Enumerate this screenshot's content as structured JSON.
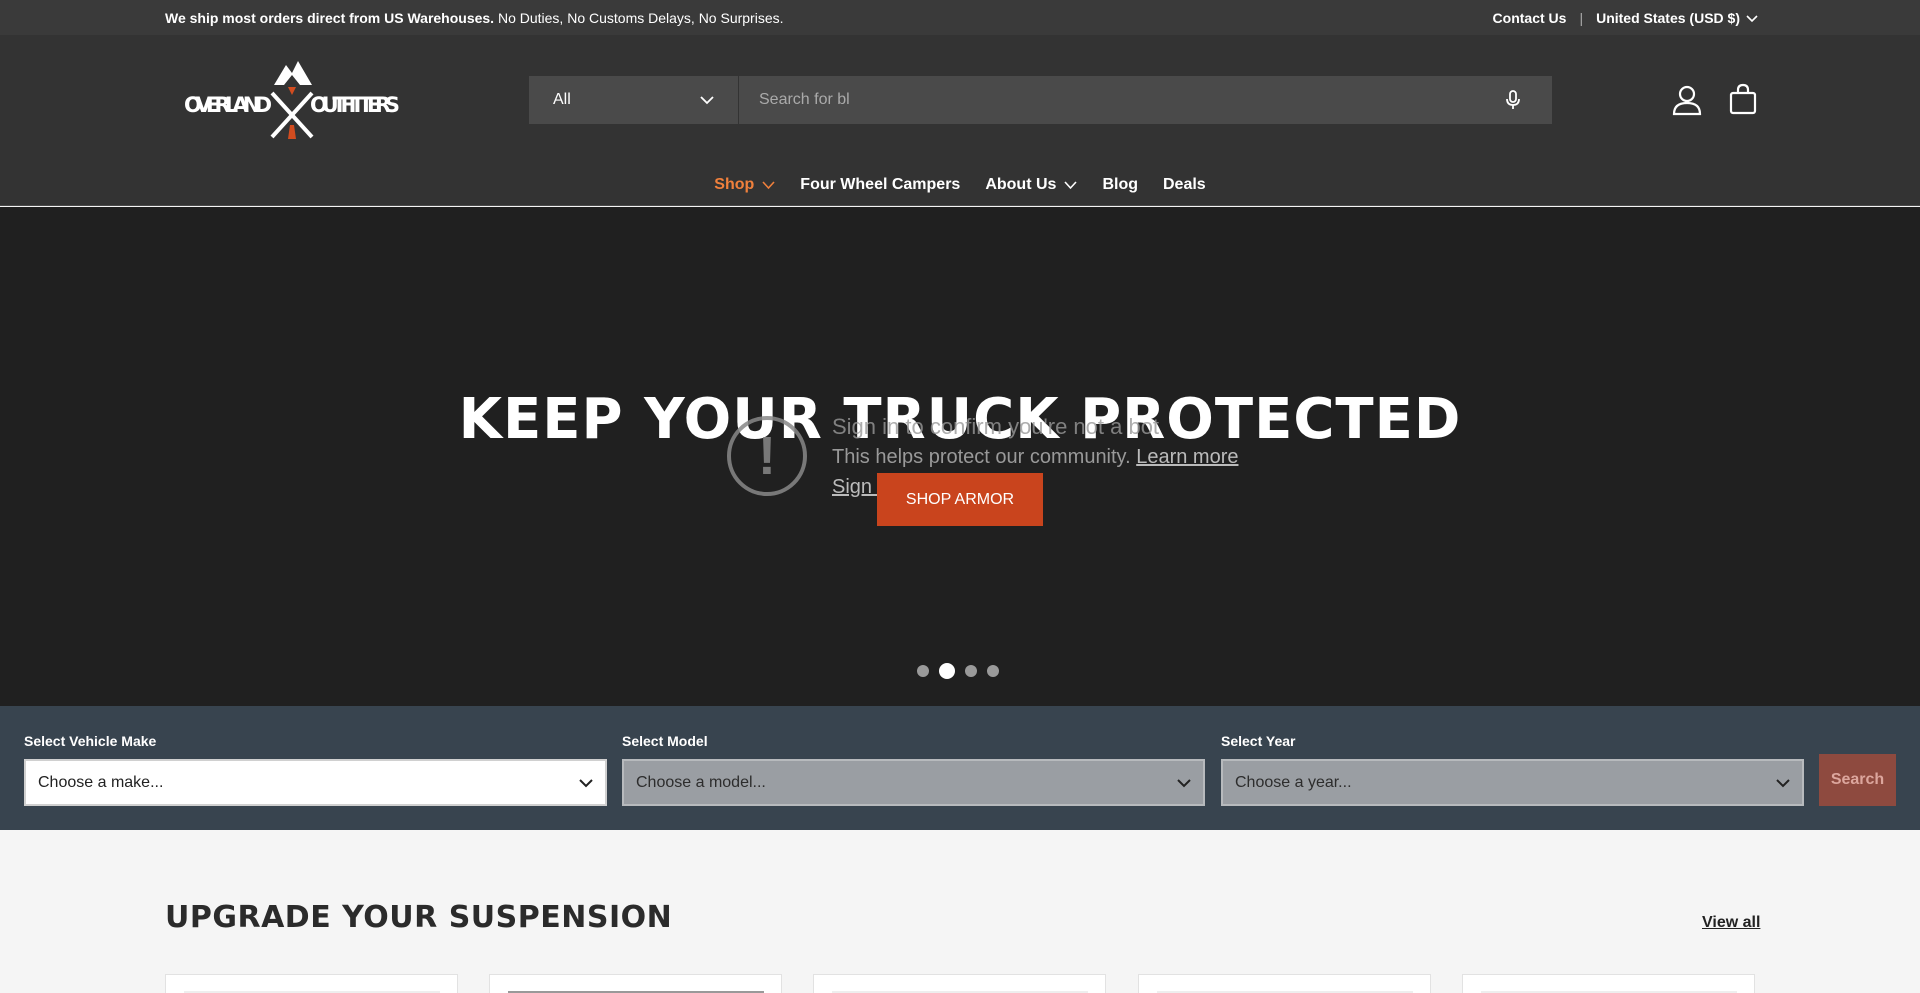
{
  "announcement": {
    "bold": "We ship most orders direct from US Warehouses.",
    "rest": " No Duties, No Customs Delays, No Surprises.",
    "contact": "Contact Us",
    "separator": "|",
    "country": "United States (USD $)"
  },
  "header": {
    "logo_text": "OVERLAND OUTFITTERS",
    "search_category": "All",
    "search_placeholder": "Search for bl",
    "icons": {
      "mic": "microphone-icon",
      "account": "account-icon",
      "cart": "cart-icon"
    }
  },
  "nav": [
    {
      "label": "Shop",
      "dropdown": true,
      "active": true
    },
    {
      "label": "Four Wheel Campers",
      "dropdown": false
    },
    {
      "label": "About Us",
      "dropdown": true
    },
    {
      "label": "Blog",
      "dropdown": false
    },
    {
      "label": "Deals",
      "dropdown": false
    }
  ],
  "hero": {
    "title": "KEEP YOUR TRUCK PROTECTED",
    "button": "SHOP ARMOR",
    "overlay_line1": "Sign in to confirm you're not a bot",
    "overlay_line2": "This helps protect our community.",
    "overlay_link": "Learn more",
    "overlay_line3": "Sign in",
    "slides": 4,
    "active_slide": 2
  },
  "vehicle": {
    "make_label": "Select Vehicle Make",
    "make_value": "Choose a make...",
    "model_label": "Select Model",
    "model_value": "Choose a model...",
    "year_label": "Select Year",
    "year_value": "Choose a year...",
    "search": "Search"
  },
  "section": {
    "title": "UPGRADE YOUR SUSPENSION",
    "view_all": "View all"
  },
  "colors": {
    "accent": "#c9441d",
    "nav_active": "#f0803c",
    "header_bg": "#333333",
    "hero_bg": "#202020",
    "vehicle_bar": "#38444f"
  }
}
